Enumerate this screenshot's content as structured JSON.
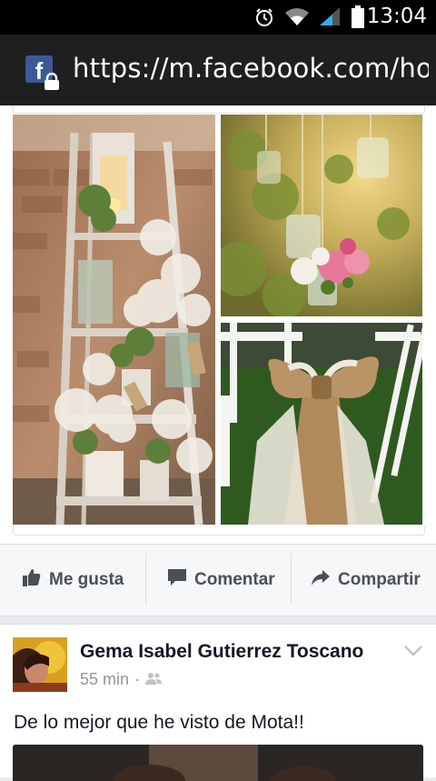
{
  "status_bar": {
    "time": "13:04",
    "icons": [
      "alarm-icon",
      "wifi-icon",
      "signal-icon",
      "battery-icon"
    ]
  },
  "url_bar": {
    "url": "https://m.facebook.com/hon",
    "icons": [
      "facebook-icon",
      "lock-icon"
    ]
  },
  "post": {
    "photos": [
      {
        "name": "ladder-flowers-photo"
      },
      {
        "name": "hanging-jars-photo"
      },
      {
        "name": "burlap-bow-chair-photo"
      }
    ],
    "actions": [
      {
        "label": "Me gusta",
        "icon": "like-icon"
      },
      {
        "label": "Comentar",
        "icon": "comment-icon"
      },
      {
        "label": "Compartir",
        "icon": "share-icon"
      }
    ]
  },
  "post2": {
    "author": "Gema Isabel Gutierrez Toscano",
    "time": "55 min",
    "separator": "·",
    "privacy_icon": "friends-icon",
    "text": "De lo mejor que he visto de Mota!!"
  },
  "colors": {
    "facebook_blue": "#3b5998",
    "action_text": "#4b4f56",
    "meta_gray": "#90949c"
  }
}
